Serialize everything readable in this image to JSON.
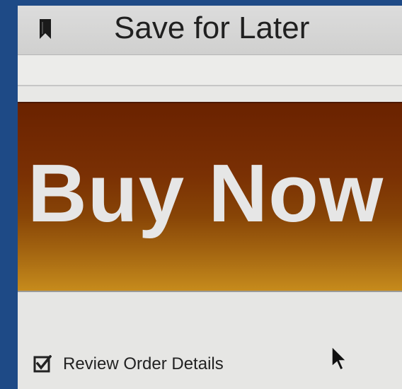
{
  "header": {
    "icon": "bookmark-icon",
    "save_label": "Save for Later"
  },
  "buy_button": {
    "label": "Buy Now",
    "colors": {
      "top": "#6a2200",
      "bottom": "#c68b1c",
      "text": "#e6e6e6"
    }
  },
  "review": {
    "checked": true,
    "label": "Review Order Details",
    "icon": "checkbox-checked-icon"
  },
  "cursor": {
    "icon": "mouse-pointer-icon"
  },
  "colors": {
    "backdrop": "#1e4a86"
  }
}
